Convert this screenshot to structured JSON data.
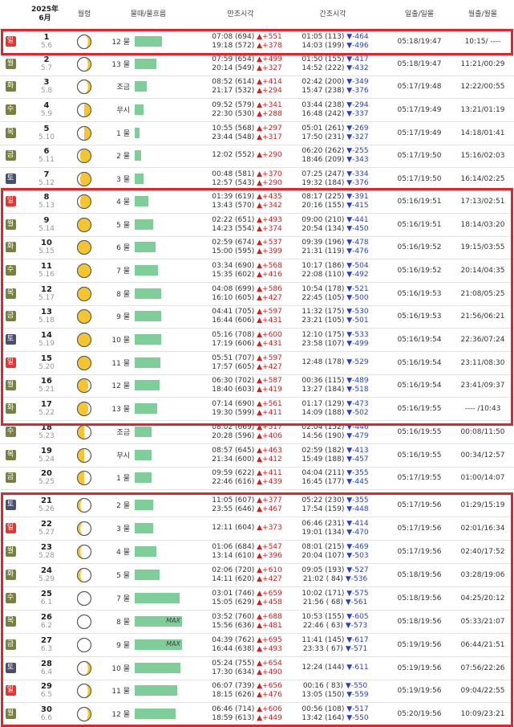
{
  "header": {
    "year_month_1": "2025年",
    "year_month_2": "6月",
    "moon": "월령",
    "tide": "물때/물흐름",
    "high": "만조시각",
    "low": "간조시각",
    "sun": "일출/일몰",
    "moonrise": "월출/월몰"
  },
  "colors": {
    "sun": "#e8342f",
    "sat": "#4a4f6b",
    "weekday": "#79803f",
    "bar": "#7fcd98",
    "highlight": "#e0232d"
  },
  "rows": [
    {
      "dow": "일",
      "date": "1",
      "lunar": "5.6",
      "moon": "crescent",
      "tide": "12 물",
      "flow": 48,
      "h1": "07:08 (694)",
      "h1d": "▲+551",
      "h2": "19:18 (572)",
      "h2d": "▲+378",
      "l1": "01:05 (113)",
      "l1d": "▼-464",
      "l2": "14:03 (199)",
      "l2d": "▼-496",
      "sun": "05:18/19:47",
      "mr": "10:15/ ----"
    },
    {
      "dow": "월",
      "date": "2",
      "lunar": "5.7",
      "moon": "crescent",
      "tide": "13 물",
      "flow": 38,
      "h1": "07:59 (654)",
      "h1d": "▲+499",
      "h2": "20:14 (549)",
      "h2d": "▲+327",
      "l1": "01:50 (155)",
      "l1d": "▼-417",
      "l2": "14:52 (222)",
      "l2d": "▼-432",
      "sun": "05:18/19:47",
      "mr": "11:21/00:29"
    },
    {
      "dow": "화",
      "date": "3",
      "lunar": "5.8",
      "moon": "crescent",
      "tide": "조금",
      "flow": 22,
      "h1": "08:52 (614)",
      "h1d": "▲+414",
      "h2": "21:17 (532)",
      "h2d": "▲+294",
      "l1": "02:42 (200)",
      "l1d": "▼-349",
      "l2": "15:47 (238)",
      "l2d": "▼-376",
      "sun": "05:17/19:48",
      "mr": "12:22/00:55"
    },
    {
      "dow": "수",
      "date": "4",
      "lunar": "5.9",
      "moon": "half",
      "tide": "무시",
      "flow": 16,
      "h1": "09:52 (579)",
      "h1d": "▲+341",
      "h2": "22:30 (530)",
      "h2d": "▲+288",
      "l1": "03:44 (238)",
      "l1d": "▼-294",
      "l2": "16:48 (242)",
      "l2d": "▼-337",
      "sun": "05:17/19:49",
      "mr": "13:21/01:19"
    },
    {
      "dow": "목",
      "date": "5",
      "lunar": "5.10",
      "moon": "half",
      "tide": "1 물",
      "flow": 8,
      "h1": "10:55 (568)",
      "h1d": "▲+297",
      "h2": "23:44 (548)",
      "h2d": "▲+317",
      "l1": "05:01 (261)",
      "l1d": "▼-269",
      "l2": "17:50 (231)",
      "l2d": "▼-327",
      "sun": "05:17/19:49",
      "mr": "14:18/01:41"
    },
    {
      "dow": "금",
      "date": "6",
      "lunar": "5.11",
      "moon": "gibbous",
      "tide": "2 물",
      "flow": 12,
      "h1": "12:02 (552)",
      "h1d": "▲+290",
      "h2": "",
      "h2d": "",
      "l1": "06:20 (262)",
      "l1d": "▼-255",
      "l2": "18:46 (209)",
      "l2d": "▼-343",
      "sun": "05:17/19:50",
      "mr": "15:16/02:03"
    },
    {
      "dow": "토",
      "date": "7",
      "lunar": "5.12",
      "moon": "gibbous",
      "tide": "3 물",
      "flow": 16,
      "h1": "00:48 (581)",
      "h1d": "▲+370",
      "h2": "12:57 (543)",
      "h2d": "▲+290",
      "l1": "07:25 (247)",
      "l1d": "▼-334",
      "l2": "19:32 (184)",
      "l2d": "▼-376",
      "sun": "05:17/19:50",
      "mr": "16:14/02:25"
    },
    {
      "dow": "일",
      "date": "8",
      "lunar": "5.13",
      "moon": "gibbous",
      "tide": "4 물",
      "flow": 24,
      "h1": "01:39 (619)",
      "h1d": "▲+435",
      "h2": "13:43 (570)",
      "h2d": "▲+342",
      "l1": "08:17 (225)",
      "l1d": "▼-391",
      "l2": "20:16 (155)",
      "l2d": "▼-415",
      "sun": "05:16/19:51",
      "mr": "17:13/02:51"
    },
    {
      "dow": "월",
      "date": "9",
      "lunar": "5.14",
      "moon": "full",
      "tide": "5 물",
      "flow": 33,
      "h1": "02:22 (651)",
      "h1d": "▲+493",
      "h2": "14:23 (554)",
      "h2d": "▲+374",
      "l1": "09:00 (210)",
      "l1d": "▼-441",
      "l2": "20:54 (134)",
      "l2d": "▼-450",
      "sun": "05:16/19:51",
      "mr": "18:14/03:20"
    },
    {
      "dow": "화",
      "date": "10",
      "lunar": "5.15",
      "moon": "full",
      "tide": "6 물",
      "flow": 37,
      "h1": "02:59 (674)",
      "h1d": "▲+537",
      "h2": "15:00 (595)",
      "h2d": "▲+399",
      "l1": "09:39 (196)",
      "l1d": "▼-478",
      "l2": "21:31 (119)",
      "l2d": "▼-476",
      "sun": "05:16/19:52",
      "mr": "19:15/03:55"
    },
    {
      "dow": "수",
      "date": "11",
      "lunar": "5.16",
      "moon": "full",
      "tide": "7 물",
      "flow": 41,
      "h1": "03:34 (690)",
      "h1d": "▲+568",
      "h2": "15:35 (602)",
      "h2d": "▲+416",
      "l1": "10:17 (186)",
      "l1d": "▼-504",
      "l2": "22:08 (110)",
      "l2d": "▼-492",
      "sun": "05:16/19:52",
      "mr": "20:14/04:35"
    },
    {
      "dow": "목",
      "date": "12",
      "lunar": "5.17",
      "moon": "full",
      "tide": "8 물",
      "flow": 47,
      "h1": "04:08 (699)",
      "h1d": "▲+586",
      "h2": "16:10 (605)",
      "h2d": "▲+427",
      "l1": "10:54 (178)",
      "l1d": "▼-521",
      "l2": "22:45 (105)",
      "l2d": "▼-500",
      "sun": "05:16/19:53",
      "mr": "21:08/05:25"
    },
    {
      "dow": "금",
      "date": "13",
      "lunar": "5.18",
      "moon": "full",
      "tide": "9 물",
      "flow": 47,
      "h1": "04:41 (705)",
      "h1d": "▲+597",
      "h2": "16:44 (606)",
      "h2d": "▲+431",
      "l1": "11:32 (175)",
      "l1d": "▼-530",
      "l2": "23:21 (105)",
      "l2d": "▼-501",
      "sun": "05:16/19:53",
      "mr": "21:56/06:21"
    },
    {
      "dow": "토",
      "date": "14",
      "lunar": "5.19",
      "moon": "full",
      "tide": "10 물",
      "flow": 47,
      "h1": "05:16 (708)",
      "h1d": "▲+600",
      "h2": "17:19 (606)",
      "h2d": "▲+431",
      "l1": "12:10 (175)",
      "l1d": "▼-533",
      "l2": "23:58 (107)",
      "l2d": "▼-499",
      "sun": "05:16/19:54",
      "mr": "22:36/07:24"
    },
    {
      "dow": "일",
      "date": "15",
      "lunar": "5.20",
      "moon": "full",
      "tide": "11 물",
      "flow": 46,
      "h1": "05:51 (707)",
      "h1d": "▲+597",
      "h2": "17:57 (605)",
      "h2d": "▲+427",
      "l1": "12:48 (178)",
      "l1d": "▼-529",
      "l2": "",
      "l2d": "",
      "sun": "05:16/19:54",
      "mr": "23:11/08:30"
    },
    {
      "dow": "월",
      "date": "16",
      "lunar": "5.21",
      "moon": "gibbous-r",
      "tide": "12 물",
      "flow": 45,
      "h1": "06:30 (702)",
      "h1d": "▲+587",
      "h2": "18:40 (603)",
      "h2d": "▲+419",
      "l1": "00:36 (115)",
      "l1d": "▼-489",
      "l2": "13:27 (184)",
      "l2d": "▼-518",
      "sun": "05:16/19:54",
      "mr": "23:41/09:37"
    },
    {
      "dow": "화",
      "date": "17",
      "lunar": "5.22",
      "moon": "gibbous-r",
      "tide": "13 물",
      "flow": 40,
      "h1": "07:14 (690)",
      "h1d": "▲+561",
      "h2": "19:30 (599)",
      "h2d": "▲+411",
      "l1": "01:17 (129)",
      "l1d": "▼-473",
      "l2": "14:09 (188)",
      "l2d": "▼-502",
      "sun": "05:16/19:55",
      "mr": "---- /10:43"
    },
    {
      "dow": "수",
      "date": "18",
      "lunar": "5.23",
      "moon": "half-r",
      "tide": "조금",
      "flow": 30,
      "h1": "08:02 (669)",
      "h1d": "▲+517",
      "h2": "20:28 (596)",
      "h2d": "▲+406",
      "l1": "02:04 (152)",
      "l1d": "▼-446",
      "l2": "14:56 (190)",
      "l2d": "▼-479",
      "sun": "05:16/19:55",
      "mr": "00:08/11:50"
    },
    {
      "dow": "목",
      "date": "19",
      "lunar": "5.24",
      "moon": "half-r",
      "tide": "무시",
      "flow": 30,
      "h1": "08:57 (645)",
      "h1d": "▲+463",
      "h2": "21:34 (600)",
      "h2d": "▲+412",
      "l1": "02:59 (182)",
      "l1d": "▼-413",
      "l2": "15:49 (188)",
      "l2d": "▼-457",
      "sun": "05:16/19:55",
      "mr": "00:34/12:57"
    },
    {
      "dow": "금",
      "date": "20",
      "lunar": "5.25",
      "moon": "half-r",
      "tide": "1 물",
      "flow": 30,
      "h1": "09:59 (622)",
      "h1d": "▲+411",
      "h2": "22:46 (616)",
      "h2d": "▲+439",
      "l1": "04:04 (211)",
      "l1d": "▼-355",
      "l2": "16:45 (177)",
      "l2d": "▼-445",
      "sun": "05:17/19:55",
      "mr": "01:00/14:07"
    },
    {
      "dow": "토",
      "date": "21",
      "lunar": "5.26",
      "moon": "crescent-r",
      "tide": "2 물",
      "flow": 33,
      "h1": "11:05 (607)",
      "h1d": "▲+377",
      "h2": "23:55 (646)",
      "h2d": "▲+467",
      "l1": "05:22 (230)",
      "l1d": "▼-355",
      "l2": "17:54 (159)",
      "l2d": "▼-448",
      "sun": "05:17/19:56",
      "mr": "01:29/15:19"
    },
    {
      "dow": "일",
      "date": "22",
      "lunar": "5.27",
      "moon": "crescent-r",
      "tide": "3 물",
      "flow": 33,
      "h1": "12:11 (604)",
      "h1d": "▲+373",
      "h2": "",
      "h2d": "",
      "l1": "06:46 (231)",
      "l1d": "▼-414",
      "l2": "19:01 (134)",
      "l2d": "▼-470",
      "sun": "05:17/19:56",
      "mr": "02:01/16:34"
    },
    {
      "dow": "월",
      "date": "23",
      "lunar": "5.28",
      "moon": "crescent-r",
      "tide": "4 물",
      "flow": 38,
      "h1": "01:06 (684)",
      "h1d": "▲+547",
      "h2": "13:14 (610)",
      "h2d": "▲+396",
      "l1": "08:01 (215)",
      "l1d": "▼-469",
      "l2": "20:04 (107)",
      "l2d": "▼-503",
      "sun": "05:17/19:56",
      "mr": "02:40/17:52"
    },
    {
      "dow": "화",
      "date": "24",
      "lunar": "5.29",
      "moon": "crescent-r",
      "tide": "5 물",
      "flow": 45,
      "h1": "02:06 (720)",
      "h1d": "▲+610",
      "h2": "14:11 (620)",
      "h2d": "▲+427",
      "l1": "09:05 (193)",
      "l1d": "▼-527",
      "l2": "21:02 ( 84)",
      "l2d": "▼-536",
      "sun": "05:18/19:56",
      "mr": "03:28/19:06"
    },
    {
      "dow": "수",
      "date": "25",
      "lunar": "6.1",
      "moon": "new",
      "tide": "7 물",
      "flow": 80,
      "h1": "03:01 (746)",
      "h1d": "▲+659",
      "h2": "15:05 (629)",
      "h2d": "▲+458",
      "l1": "10:02 (171)",
      "l1d": "▼-575",
      "l2": "21:56 ( 68)",
      "l2d": "▼-561",
      "sun": "05:18/19:56",
      "mr": "04:25/20:12"
    },
    {
      "dow": "목",
      "date": "26",
      "lunar": "6.2",
      "moon": "new",
      "tide": "8 물",
      "flow": 85,
      "max": "MAX",
      "h1": "03:52 (760)",
      "h1d": "▲+688",
      "h2": "15:56 (636)",
      "h2d": "▲+481",
      "l1": "10:53 (155)",
      "l1d": "▼-605",
      "l2": "22:46 ( 63)",
      "l2d": "▼-573",
      "sun": "05:18/19:56",
      "mr": "05:33/21:07"
    },
    {
      "dow": "금",
      "date": "27",
      "lunar": "6.3",
      "moon": "new",
      "tide": "9 물",
      "flow": 85,
      "max": "MAX",
      "h1": "04:39 (762)",
      "h1d": "▲+695",
      "h2": "16:44 (638)",
      "h2d": "▲+493",
      "l1": "11:41 (145)",
      "l1d": "▼-617",
      "l2": "23:33 ( 67)",
      "l2d": "▼-571",
      "sun": "05:19/19:56",
      "mr": "06:44/21:51"
    },
    {
      "dow": "토",
      "date": "28",
      "lunar": "6.4",
      "moon": "crescent",
      "tide": "10 물",
      "flow": 82,
      "h1": "05:24 (755)",
      "h1d": "▲+654",
      "h2": "17:30 (634)",
      "h2d": "▲+490",
      "l1": "12:24 (144)",
      "l1d": "▼-611",
      "l2": "",
      "l2d": "",
      "sun": "05:19/19:56",
      "mr": "07:56/22:26"
    },
    {
      "dow": "일",
      "date": "29",
      "lunar": "6.5",
      "moon": "crescent",
      "tide": "11 물",
      "flow": 76,
      "h1": "06:07 (739)",
      "h1d": "▲+656",
      "h2": "18:15 (626)",
      "h2d": "▲+476",
      "l1": "00:16 ( 83)",
      "l1d": "▼-550",
      "l2": "13:05 (150)",
      "l2d": "▼-559",
      "sun": "05:19/19:56",
      "mr": "09:04/22:55"
    },
    {
      "dow": "월",
      "date": "30",
      "lunar": "6.6",
      "moon": "crescent",
      "tide": "12 물",
      "flow": 73,
      "h1": "06:46 (714)",
      "h1d": "▲+606",
      "h2": "18:59 (613)",
      "h2d": "▲+449",
      "l1": "00:56 (108)",
      "l1d": "▼-517",
      "l2": "13:42 (164)",
      "l2d": "▼-550",
      "sun": "05:20/19:56",
      "mr": "10:09/23:21"
    }
  ]
}
